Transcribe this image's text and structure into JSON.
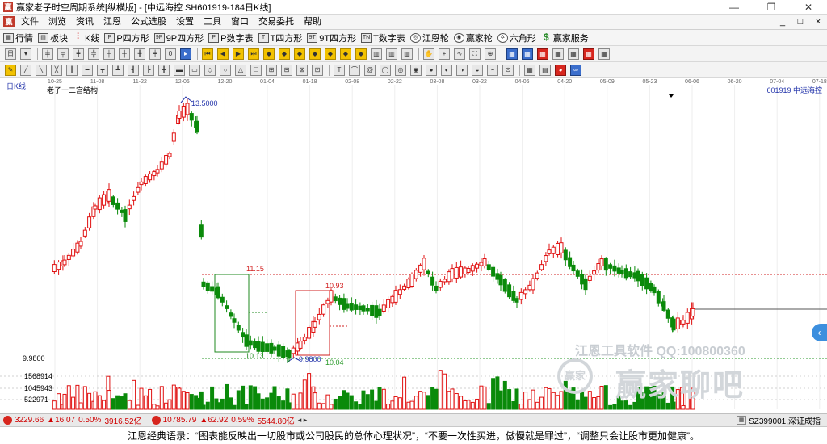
{
  "window": {
    "title": "赢家老子时空周期系统[纵横版] - [中远海控  SH601919-184日K线]",
    "app_icon": "赢",
    "controls": [
      "—",
      "❐",
      "✕"
    ]
  },
  "menu": {
    "logo": "赢",
    "items": [
      "文件",
      "浏览",
      "资讯",
      "江恩",
      "公式选股",
      "设置",
      "工具",
      "窗口",
      "交易委托",
      "帮助"
    ],
    "right_controls": [
      "_",
      "□",
      "×"
    ]
  },
  "toolbar1": {
    "buttons": [
      {
        "label": "行情",
        "icon": "grid-icon"
      },
      {
        "label": "板块",
        "icon": "blocks-icon"
      },
      {
        "label": "K线",
        "icon": "kline-icon"
      },
      {
        "label": "P四方形",
        "icon": "p-square-icon"
      },
      {
        "label": "9P四方形",
        "icon": "9p-square-icon"
      },
      {
        "label": "P数字表",
        "icon": "p-table-icon"
      },
      {
        "label": "T四方形",
        "icon": "t-square-icon"
      },
      {
        "label": "9T四方形",
        "icon": "9t-square-icon"
      },
      {
        "label": "T数字表",
        "icon": "t-table-icon"
      },
      {
        "label": "江恩轮",
        "icon": "gann-wheel-icon"
      },
      {
        "label": "赢家轮",
        "icon": "winner-wheel-icon"
      },
      {
        "label": "六角形",
        "icon": "hexagon-icon"
      },
      {
        "label": "赢家服务",
        "icon": "dollar-icon"
      }
    ]
  },
  "chart": {
    "period_label": "日K线",
    "indicator_label": "老子十二宫结构",
    "symbol_label": "601919  中远海控",
    "date_ticks": [
      "10-25",
      "11-08",
      "11-22",
      "12-06",
      "12-20",
      "01-04",
      "01-18",
      "02-08",
      "02-22",
      "03-08",
      "03-22",
      "04-06",
      "04-20",
      "05-09",
      "05-23",
      "06-06",
      "06-20",
      "07-04",
      "07-18"
    ],
    "annotations": {
      "high": "13.5000",
      "level_upper": "11.15",
      "box2_top": "10.93",
      "box1_low": "10.13",
      "box2_low": "9.9800",
      "level_lower": "10.04",
      "axis_low": "9.9800"
    },
    "volume_ticks": [
      "1568914",
      "1045943",
      "522971"
    ]
  },
  "chart_data": {
    "type": "candlestick",
    "price_ylim": [
      9.98,
      13.5
    ],
    "reference_levels": [
      11.15,
      10.04
    ],
    "volume_ticks": [
      1568914,
      1045943,
      522971
    ]
  },
  "status": {
    "sh_index": "3229.66",
    "sh_change": "16.07",
    "sh_pct": "0.50%",
    "sh_amount": "3916.52亿",
    "sz_index": "10785.79",
    "sz_change": "62.92",
    "sz_pct": "0.59%",
    "sz_amount": "5544.80亿",
    "right_label": "SZ399001,深证成指"
  },
  "quote": "江恩经典语录：“图表能反映出一切股市或公司股民的总体心理状况”，“不要一次性买进，傲慢就是罪过”，“调整只会让股市更加健康”。",
  "watermark": {
    "line1": "江恩工具软件   QQ:100800360",
    "logo": "赢家",
    "line2": "赢家聊吧"
  },
  "colors": {
    "up": "#e01010",
    "down": "#0a8a0a",
    "accent_blue": "#3c8fde",
    "level_red": "#d22020",
    "level_green": "#2a9a2a"
  }
}
